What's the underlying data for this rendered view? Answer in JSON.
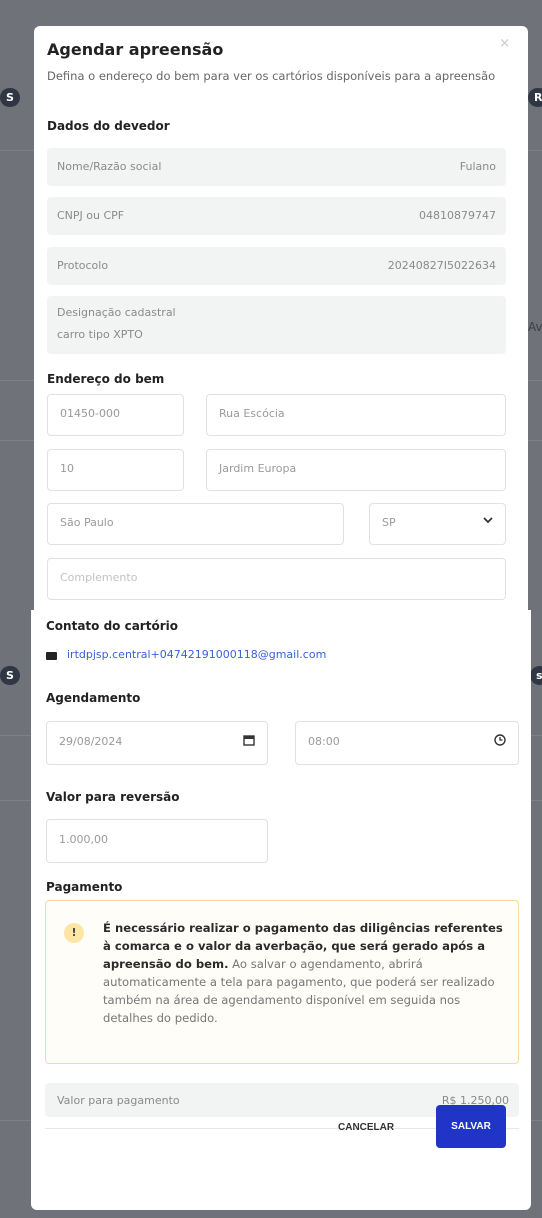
{
  "modal": {
    "title": "Agendar apreensão",
    "close_label": "×",
    "subtitle": "Defina o endereço do bem para ver os cartórios disponíveis para a apreensão"
  },
  "debtor": {
    "section_label": "Dados do devedor",
    "name_label": "Nome/Razão social",
    "name_value": "Fulano",
    "doc_label": "CNPJ ou CPF",
    "doc_value": "04810879747",
    "protocol_label": "Protocolo",
    "protocol_value": "20240827I5022634",
    "designation_label": "Designação cadastral",
    "designation_value": "carro tipo XPTO"
  },
  "address": {
    "section_label": "Endereço do bem",
    "cep": "01450-000",
    "street": "Rua Escócia",
    "number": "10",
    "district": "Jardim Europa",
    "city": "São Paulo",
    "state": "SP",
    "complement_placeholder": "Complemento"
  },
  "contact": {
    "section_label": "Contato do cartório",
    "email": "irtdpjsp.central+04742191000118@gmail.com"
  },
  "schedule": {
    "section_label": "Agendamento",
    "date": "29/08/2024",
    "time": "08:00"
  },
  "reversal": {
    "section_label": "Valor para reversão",
    "value": "1.000,00"
  },
  "payment": {
    "section_label": "Pagamento",
    "warning_bold": "É necessário realizar o pagamento das diligências referentes à comarca e o valor da averbação, que será gerado após a apreensão do bem.",
    "warning_text": " Ao salvar o agendamento, abrirá automaticamente a tela para pagamento, que poderá ser realizado também na área de agendamento disponível em seguida nos detalhes do pedido.",
    "total_label": "Valor para pagamento",
    "total_value": "R$ 1.250,00"
  },
  "actions": {
    "cancel_label": "CANCELAR",
    "save_label": "SALVAR"
  },
  "icons": {
    "calendar": "calendar-icon",
    "clock": "clock-icon",
    "mail": "mail-icon",
    "warning": "warning-icon",
    "chevron": "chevron-down-icon"
  },
  "colors": {
    "primary": "#2035c8",
    "link": "#3a5fd8",
    "warning_border": "#f7d9a3",
    "warning_icon_bg": "#fde5a6",
    "overlay": "#6f7278"
  },
  "background": {
    "left_badge": "S",
    "right_badge": "R",
    "right_badge2": "s",
    "right_fragment": "Av"
  }
}
